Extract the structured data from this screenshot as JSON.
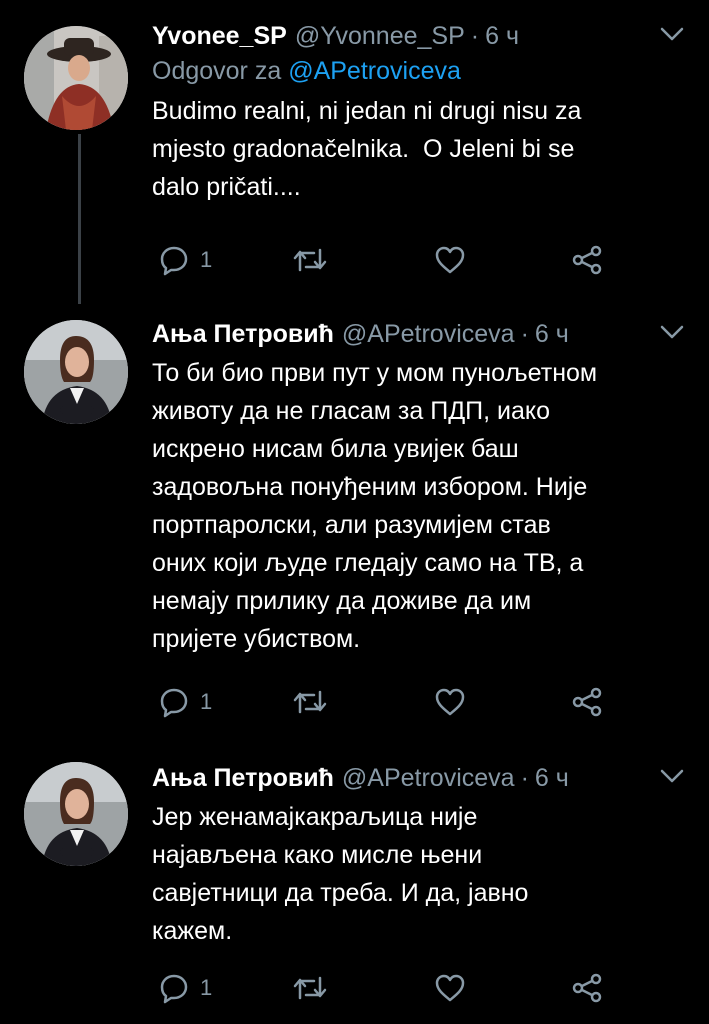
{
  "colors": {
    "background": "#000000",
    "text": "#ffffff",
    "secondary": "#8899a6",
    "accent": "#1da1f2",
    "thread_line": "#3b4147"
  },
  "tweets": [
    {
      "display_name": "Yvonee_SP",
      "handle": "@Yvonnee_SP",
      "separator": "·",
      "time": "6 ч",
      "reply_to_label": "Odgovor za",
      "reply_to_handle": "@APetroviceva",
      "text": "Budimo realni, ni jedan ni drugi nisu za\nmjesto gradonačelnika.  O Jeleni bi se\ndalo pričati....",
      "reply_count": "1",
      "avatar": "woman-in-hat-avatar"
    },
    {
      "display_name": "Ања Петровић",
      "handle": "@APetroviceva",
      "separator": "·",
      "time": "6 ч",
      "text": "То би био први пут у мом пунољетном\nживоту да не гласам за ПДП, иако\nискрено нисам била увијек баш\nзадовољна понуђеним избором. Није\nпортпаролски, али разумијем став\nоних који људе гледају само на ТВ, а\nнемају прилику да доживе да им\nпријете убиством.",
      "reply_count": "1",
      "avatar": "woman-portrait-avatar"
    },
    {
      "display_name": "Ања Петровић",
      "handle": "@APetroviceva",
      "separator": "·",
      "time": "6 ч",
      "text": "Јер женамајкакраљица није\nнајављена како мисле њени\nсавјетници да треба. И да, јавно\nкажем.",
      "reply_count": "1",
      "avatar": "woman-portrait-avatar"
    }
  ],
  "actions": {
    "reply_icon": "reply-icon",
    "retweet_icon": "retweet-icon",
    "like_icon": "like-icon",
    "share_icon": "share-icon"
  }
}
